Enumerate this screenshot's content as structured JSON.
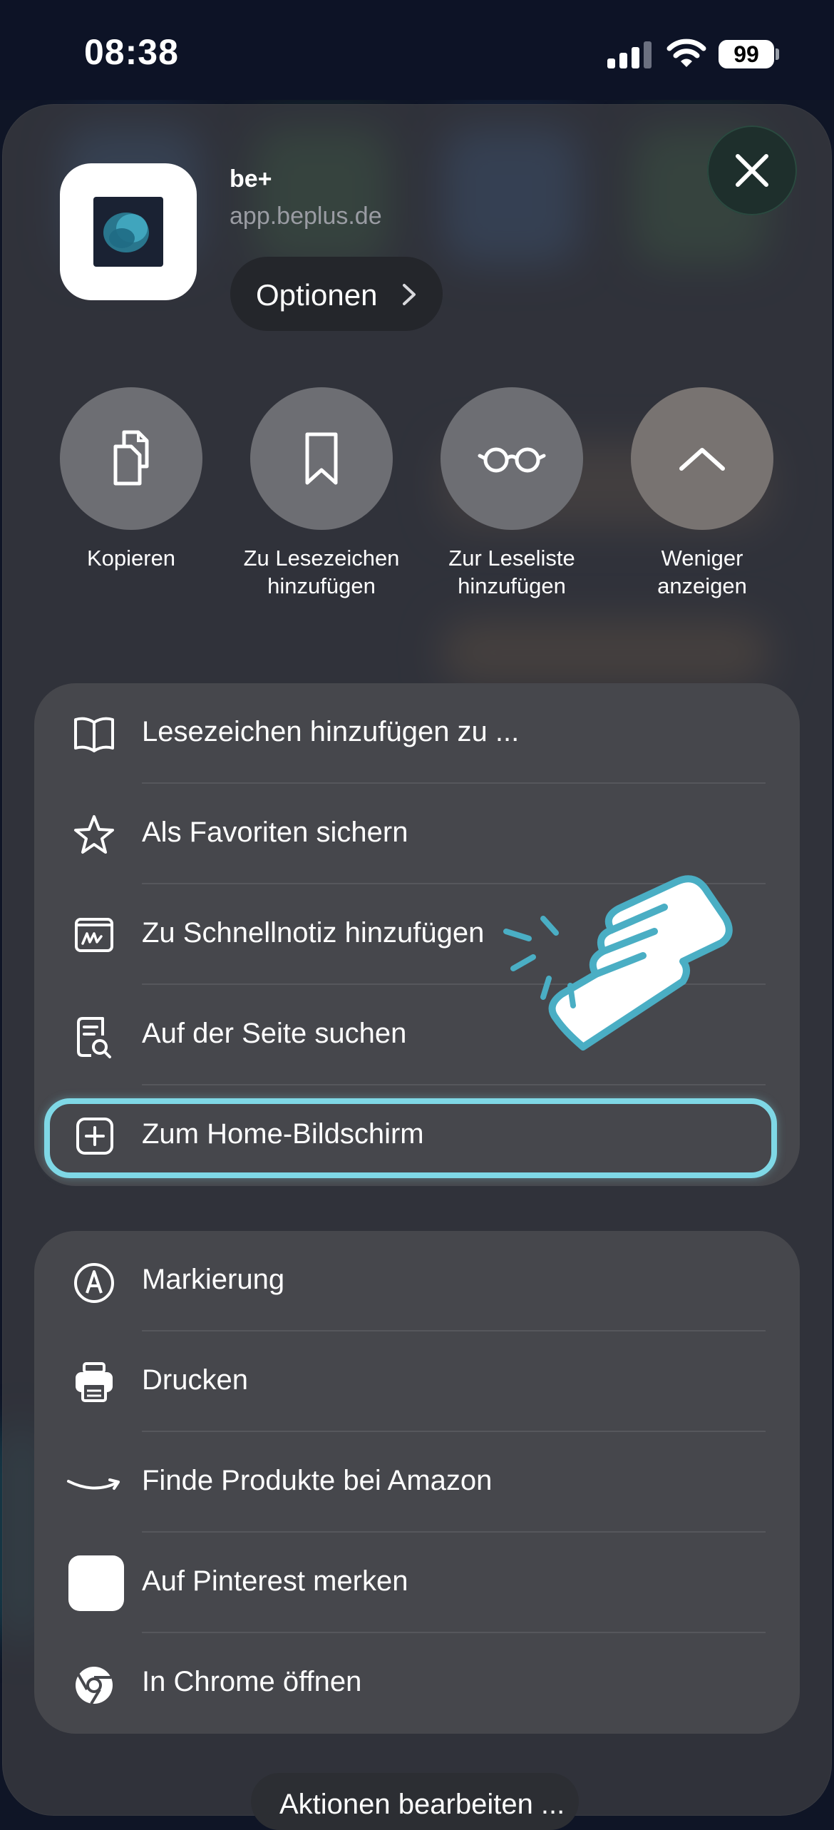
{
  "status_bar": {
    "time": "08:38",
    "battery": "99"
  },
  "share_sheet": {
    "app_name": "be+",
    "app_url": "app.beplus.de",
    "options_label": "Optionen",
    "accent_color": "#7fd8e6"
  },
  "actions": [
    {
      "label": "Kopieren",
      "icon": "copy-icon"
    },
    {
      "label": "Zu Lesezeichen hinzufügen",
      "icon": "bookmark-icon"
    },
    {
      "label": "Zur Leseliste hinzufügen",
      "icon": "glasses-icon"
    },
    {
      "label": "Weniger anzeigen",
      "icon": "chevron-up-icon"
    }
  ],
  "menu_group_1": [
    {
      "label": "Lesezeichen hinzufügen zu ...",
      "icon": "book-icon"
    },
    {
      "label": "Als Favoriten sichern",
      "icon": "star-icon"
    },
    {
      "label": "Zu Schnellnotiz hinzufügen",
      "icon": "quick-note-icon"
    },
    {
      "label": "Auf der Seite suchen",
      "icon": "find-on-page-icon"
    },
    {
      "label": "Zum Home-Bildschirm",
      "icon": "add-square-icon"
    }
  ],
  "menu_group_2": [
    {
      "label": "Markierung",
      "icon": "markup-icon"
    },
    {
      "label": "Drucken",
      "icon": "printer-icon"
    },
    {
      "label": "Finde Produkte bei Amazon",
      "icon": "amazon-icon"
    },
    {
      "label": "Auf Pinterest merken",
      "icon": "pinterest-icon"
    },
    {
      "label": "In Chrome öffnen",
      "icon": "chrome-icon"
    }
  ],
  "edit_actions_label": "Aktionen bearbeiten ..."
}
